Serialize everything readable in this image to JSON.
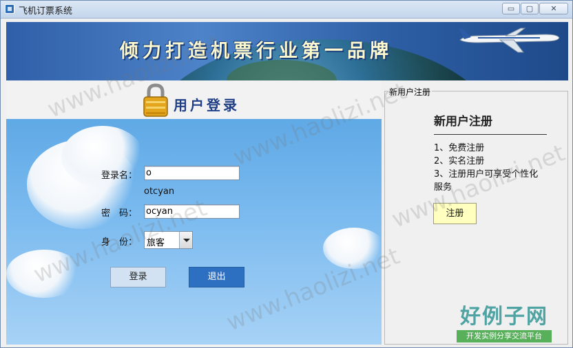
{
  "window": {
    "title": "飞机订票系统",
    "minimize_glyph": "▭",
    "maximize_glyph": "▢",
    "close_glyph": "✕"
  },
  "banner": {
    "slogan": "倾力打造机票行业第一品牌"
  },
  "login": {
    "heading": "用户登录",
    "username_label": "登录名：",
    "username_value": "o",
    "username_hint": "otcyan",
    "password_label": "密　码：",
    "password_value": "ocyan",
    "role_label": "身　份：",
    "role_selected": "旅客",
    "login_button": "登录",
    "exit_button": "退出"
  },
  "register": {
    "group_title": "新用户注册",
    "heading": "新用户注册",
    "items": [
      "1、免费注册",
      "2、实名注册",
      "3、注册用户可享受个性化",
      "服务"
    ],
    "register_button": "注册"
  },
  "watermark": {
    "brand": "好例子网",
    "tagline": "开发实例分享交流平台",
    "url": "www.haolizi.net"
  },
  "icons": [
    "app-icon",
    "lock-icon",
    "airplane-icon",
    "dropdown-arrow-icon"
  ]
}
